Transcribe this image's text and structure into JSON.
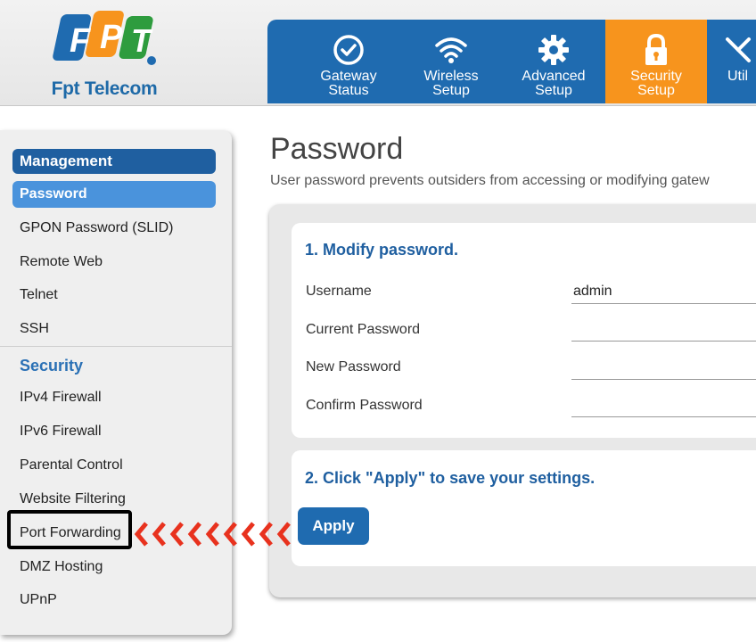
{
  "brand": {
    "logo_letters": [
      "F",
      "P",
      "T"
    ],
    "logo_dot_color": "#2e9c3e",
    "caption": "Fpt Telecom",
    "colors": {
      "blue": "#1f6bb0",
      "orange": "#f7941d",
      "green": "#2e9c3e"
    }
  },
  "nav": {
    "tabs": [
      {
        "label_line1": "Gateway",
        "label_line2": "Status",
        "icon": "check-circle-icon",
        "active": false
      },
      {
        "label_line1": "Wireless",
        "label_line2": "Setup",
        "icon": "wifi-icon",
        "active": false
      },
      {
        "label_line1": "Advanced",
        "label_line2": "Setup",
        "icon": "gear-icon",
        "active": false
      },
      {
        "label_line1": "Security",
        "label_line2": "Setup",
        "icon": "lock-icon",
        "active": true
      },
      {
        "label_line1": "Util",
        "label_line2": "",
        "icon": "tools-icon",
        "active": false
      }
    ]
  },
  "sidebar": {
    "management_heading": "Management",
    "management_items": [
      "Password",
      "GPON Password (SLID)",
      "Remote Web",
      "Telnet",
      "SSH"
    ],
    "security_heading": "Security",
    "security_items": [
      "IPv4 Firewall",
      "IPv6 Firewall",
      "Parental Control",
      "Website Filtering",
      "Port Forwarding",
      "DMZ Hosting",
      "UPnP"
    ],
    "active_item": "Password",
    "highlighted_item": "Port Forwarding"
  },
  "main": {
    "title": "Password",
    "description": "User password prevents outsiders from accessing or modifying gatew",
    "section1_title": "1. Modify password.",
    "fields": [
      {
        "label": "Username",
        "value": "admin"
      },
      {
        "label": "Current Password",
        "value": ""
      },
      {
        "label": "New Password",
        "value": ""
      },
      {
        "label": "Confirm Password",
        "value": ""
      }
    ],
    "section2_title": "2. Click \"Apply\" to save your settings.",
    "apply_label": "Apply"
  },
  "annotation": {
    "arrow_color": "#e8321e",
    "box_color": "#000000"
  }
}
